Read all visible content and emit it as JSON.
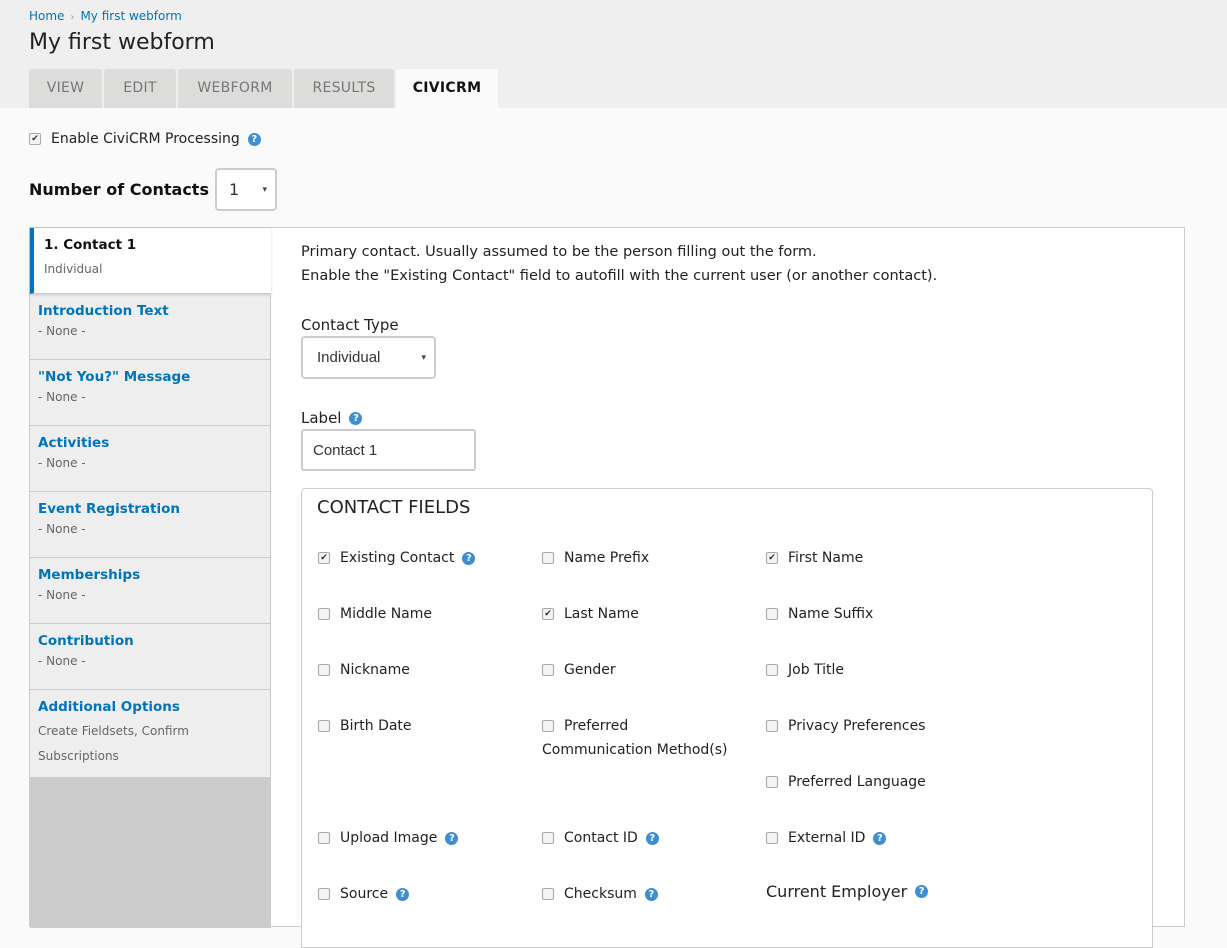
{
  "breadcrumb": {
    "items": [
      "Home",
      "My first webform"
    ],
    "separator": "›"
  },
  "page_title": "My first webform",
  "tabs": [
    {
      "label": "VIEW",
      "active": false
    },
    {
      "label": "EDIT",
      "active": false
    },
    {
      "label": "WEBFORM",
      "active": false
    },
    {
      "label": "RESULTS",
      "active": false
    },
    {
      "label": "CIVICRM",
      "active": true
    }
  ],
  "enable_processing": {
    "label": "Enable CiviCRM Processing",
    "checked": true,
    "help_icon": "question-circle"
  },
  "number_of_contacts": {
    "label": "Number of Contacts",
    "value": "1",
    "caret": "▾"
  },
  "vertical_tabs": [
    {
      "title": "1. Contact 1",
      "summary": "Individual",
      "active": true
    },
    {
      "title": "Introduction Text",
      "summary": "- None -"
    },
    {
      "title": "\"Not You?\" Message",
      "summary": "- None -"
    },
    {
      "title": "Activities",
      "summary": "- None -"
    },
    {
      "title": "Event Registration",
      "summary": "- None -"
    },
    {
      "title": "Memberships",
      "summary": "- None -"
    },
    {
      "title": "Contribution",
      "summary": "- None -"
    },
    {
      "title": "Additional Options",
      "summary": "Create Fieldsets, Confirm Subscriptions"
    }
  ],
  "contact": {
    "intro_line1": "Primary contact. Usually assumed to be the person filling out the form.",
    "intro_line2": "Enable the \"Existing Contact\" field to autofill with the current user (or another contact).",
    "contact_type_label": "Contact Type",
    "contact_type_value": "Individual",
    "label_label": "Label",
    "label_value": "Contact 1",
    "fieldset_title": "CONTACT FIELDS",
    "fields": [
      {
        "label": "Existing Contact",
        "checked": true,
        "help": true
      },
      {
        "label": "Name Prefix",
        "checked": false
      },
      {
        "label": "First Name",
        "checked": true
      },
      {
        "label": "Middle Name",
        "checked": false
      },
      {
        "label": "Last Name",
        "checked": true
      },
      {
        "label": "Name Suffix",
        "checked": false
      },
      {
        "label": "Nickname",
        "checked": false
      },
      {
        "label": "Gender",
        "checked": false
      },
      {
        "label": "Job Title",
        "checked": false
      },
      {
        "label": "Birth Date",
        "checked": false
      },
      {
        "label": "Preferred Communication Method(s)",
        "checked": false
      },
      {
        "label": "Privacy Preferences",
        "checked": false
      },
      {
        "label": "Preferred Language",
        "checked": false
      },
      {
        "label": "Upload Image",
        "checked": false,
        "help": true
      },
      {
        "label": "Contact ID",
        "checked": false,
        "help": true
      },
      {
        "label": "External ID",
        "checked": false,
        "help": true
      },
      {
        "label": "Source",
        "checked": false,
        "help": true
      },
      {
        "label": "Checksum",
        "checked": false,
        "help": true
      }
    ],
    "current_employer_label": "Current Employer"
  },
  "icons": {
    "help": "?",
    "check": "✔"
  },
  "colors": {
    "link": "#0074bd",
    "help_icon": "#3d8fd1",
    "active_tab_border": "#0074bd"
  }
}
